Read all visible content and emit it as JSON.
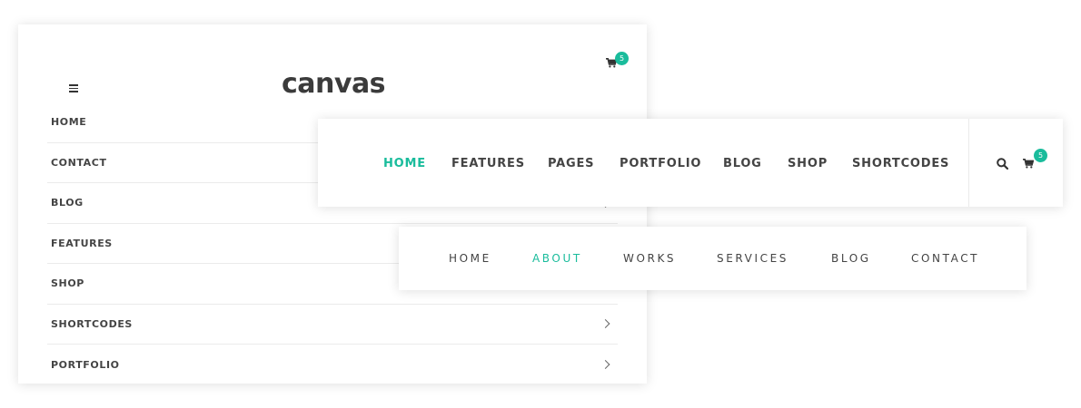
{
  "colors": {
    "accent": "#1abc9c",
    "text": "#444444"
  },
  "mobile": {
    "logo": "canvas",
    "cart_count": "5",
    "items": [
      {
        "label": "HOME",
        "has_submenu": false
      },
      {
        "label": "CONTACT",
        "has_submenu": false
      },
      {
        "label": "BLOG",
        "has_submenu": true
      },
      {
        "label": "FEATURES",
        "has_submenu": false
      },
      {
        "label": "SHOP",
        "has_submenu": false
      },
      {
        "label": "SHORTCODES",
        "has_submenu": true
      },
      {
        "label": "PORTFOLIO",
        "has_submenu": true
      }
    ]
  },
  "header": {
    "items": [
      {
        "label": "HOME",
        "active": true
      },
      {
        "label": "FEATURES",
        "active": false
      },
      {
        "label": "PAGES",
        "active": false
      },
      {
        "label": "PORTFOLIO",
        "active": false
      },
      {
        "label": "BLOG",
        "active": false
      },
      {
        "label": "SHOP",
        "active": false
      },
      {
        "label": "SHORTCODES",
        "active": false
      }
    ],
    "cart_count": "5",
    "icons": [
      "search-icon",
      "cart-icon"
    ]
  },
  "spaced": {
    "items": [
      {
        "label": "HOME",
        "active": false
      },
      {
        "label": "ABOUT",
        "active": true
      },
      {
        "label": "WORKS",
        "active": false
      },
      {
        "label": "SERVICES",
        "active": false
      },
      {
        "label": "BLOG",
        "active": false
      },
      {
        "label": "CONTACT",
        "active": false
      }
    ]
  }
}
